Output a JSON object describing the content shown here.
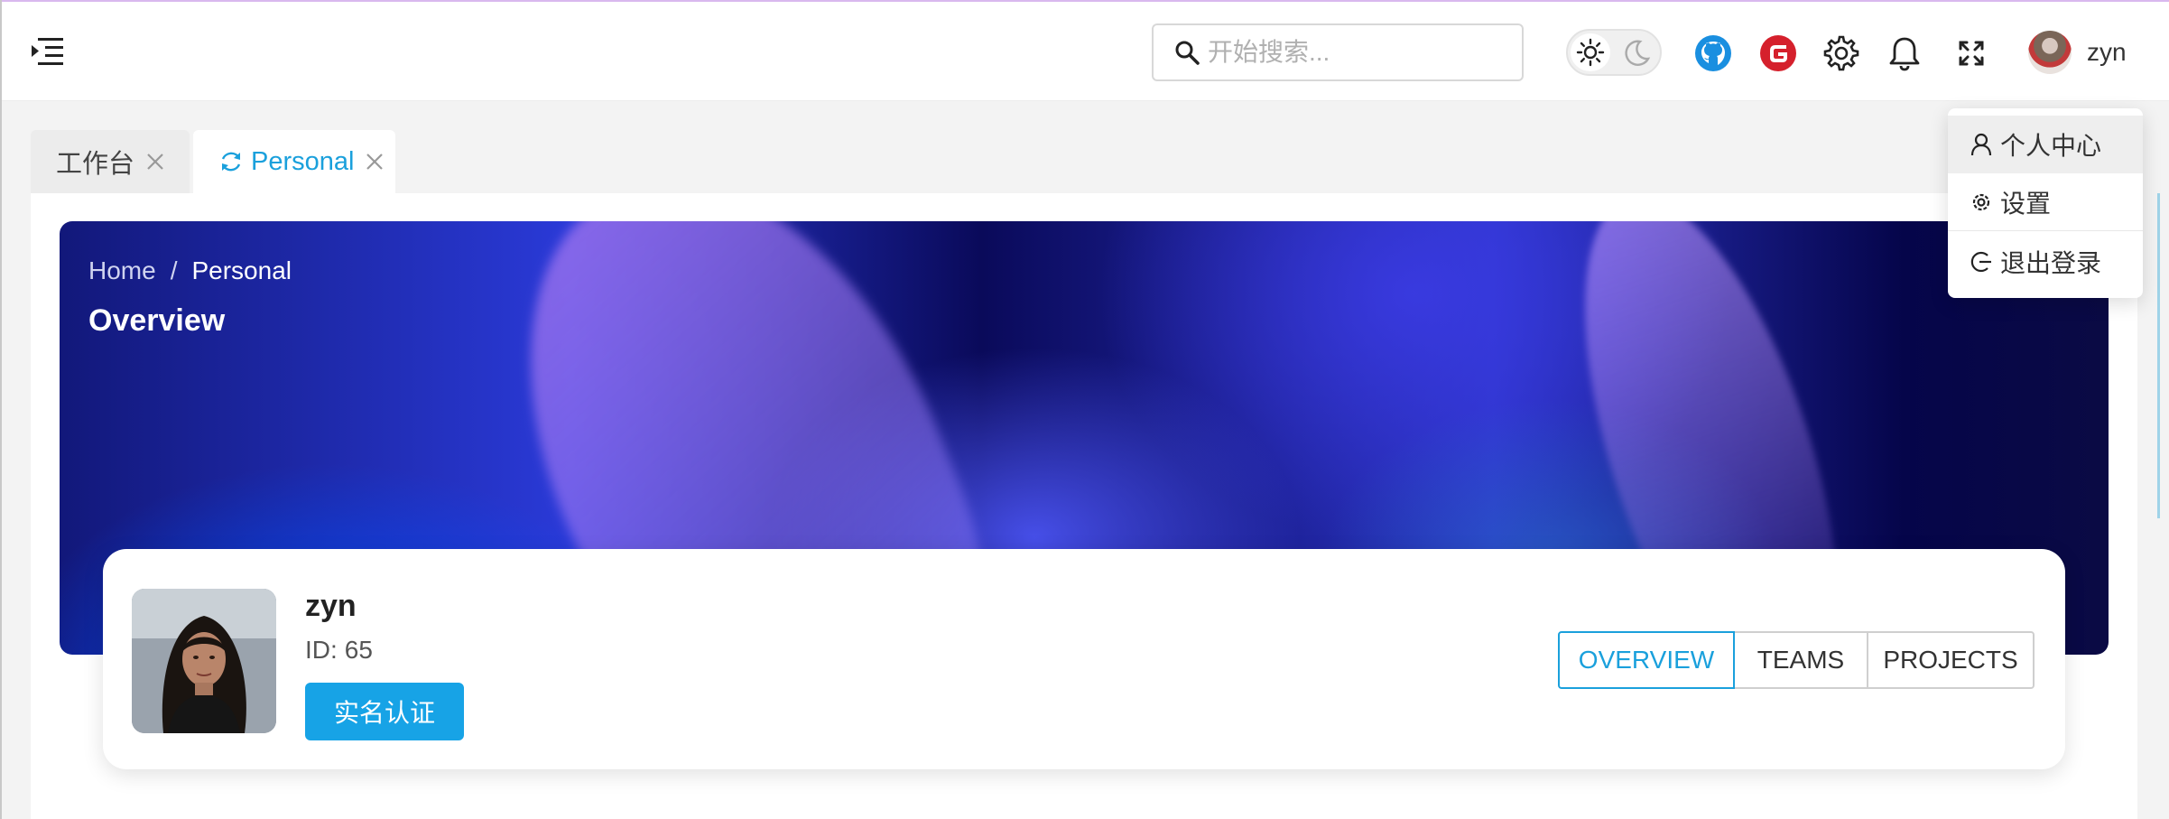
{
  "header": {
    "search_placeholder": "开始搜索...",
    "username": "zyn",
    "icons": [
      "menu-toggle-icon",
      "search-icon",
      "sun-icon",
      "moon-icon",
      "github-icon",
      "gitee-icon",
      "gear-icon",
      "bell-icon",
      "fullscreen-icon"
    ]
  },
  "tabs": [
    {
      "label": "工作台",
      "active": false
    },
    {
      "label": "Personal",
      "active": true
    }
  ],
  "banner": {
    "breadcrumb": [
      "Home",
      "/",
      "Personal"
    ],
    "title": "Overview"
  },
  "profile": {
    "name": "zyn",
    "id_label": "ID:",
    "id_value": "65",
    "verify_button": "实名认证",
    "segments": [
      {
        "label": "OVERVIEW",
        "active": true
      },
      {
        "label": "TEAMS",
        "active": false
      },
      {
        "label": "PROJECTS",
        "active": false
      }
    ]
  },
  "dropdown": {
    "items": [
      {
        "label": "个人中心",
        "icon": "user-icon"
      },
      {
        "label": "设置",
        "icon": "gear-icon"
      },
      {
        "label": "退出登录",
        "icon": "logout-icon"
      }
    ]
  },
  "colors": {
    "accent": "#1aa0dc",
    "verify_button": "#17a3e6",
    "github": "#1a8fe0",
    "gitee": "#d5202c"
  }
}
